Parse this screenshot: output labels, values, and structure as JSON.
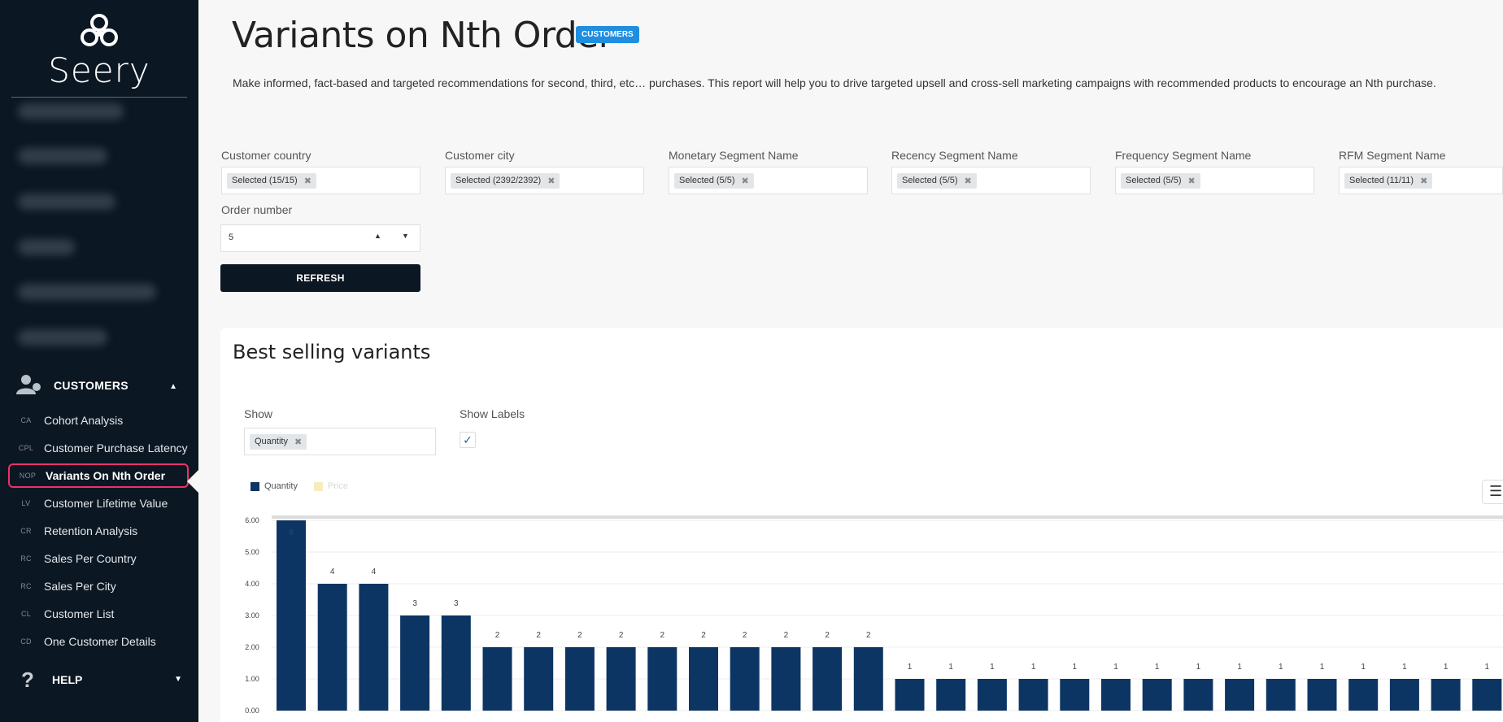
{
  "sidebar": {
    "logo_text": "Seery",
    "section": {
      "label": "CUSTOMERS"
    },
    "items": [
      {
        "abbr": "CA",
        "label": "Cohort Analysis"
      },
      {
        "abbr": "CPL",
        "label": "Customer Purchase Latency"
      },
      {
        "abbr": "NOP",
        "label": "Variants On Nth Order"
      },
      {
        "abbr": "LV",
        "label": "Customer Lifetime Value"
      },
      {
        "abbr": "CR",
        "label": "Retention Analysis"
      },
      {
        "abbr": "RC",
        "label": "Sales Per Country"
      },
      {
        "abbr": "RC",
        "label": "Sales Per City"
      },
      {
        "abbr": "CL",
        "label": "Customer List"
      },
      {
        "abbr": "CD",
        "label": "One Customer Details"
      }
    ],
    "help": {
      "label": "HELP"
    }
  },
  "header": {
    "title": "Variants on Nth Order",
    "badge": "CUSTOMERS",
    "description": "Make informed, fact-based and targeted recommendations for second, third, etc… purchases. This report will help you to drive targeted upsell and cross-sell marketing campaigns with recommended products to encourage an Nth purchase."
  },
  "filters": [
    {
      "label": "Customer country",
      "chip": "Selected (15/15)"
    },
    {
      "label": "Customer city",
      "chip": "Selected (2392/2392)"
    },
    {
      "label": "Monetary Segment Name",
      "chip": "Selected (5/5)"
    },
    {
      "label": "Recency Segment Name",
      "chip": "Selected (5/5)"
    },
    {
      "label": "Frequency Segment Name",
      "chip": "Selected (5/5)"
    },
    {
      "label": "RFM Segment Name",
      "chip": "Selected (11/11)"
    }
  ],
  "order_number": {
    "label": "Order number",
    "value": "5"
  },
  "refresh_label": "REFRESH",
  "card": {
    "title": "Best selling variants",
    "show_label": "Show",
    "show_chip": "Quantity",
    "show_labels_label": "Show Labels",
    "show_labels_checked": true
  },
  "colors": {
    "quantity": "#0d3563",
    "price": "#f7ecc0",
    "accent": "#1f8ee0",
    "active_border": "#e8336b"
  },
  "chart_data": {
    "type": "bar",
    "title": "",
    "legend": [
      "Quantity",
      "Price"
    ],
    "legend_position": "top-left",
    "ylim": [
      0,
      6
    ],
    "yticks": [
      "0.00",
      "1.00",
      "2.00",
      "3.00",
      "4.00",
      "5.00",
      "6.00"
    ],
    "grid": true,
    "series": [
      {
        "name": "Quantity",
        "values": [
          6,
          4,
          4,
          3,
          3,
          2,
          2,
          2,
          2,
          2,
          2,
          2,
          2,
          2,
          2,
          1,
          1,
          1,
          1,
          1,
          1,
          1,
          1,
          1,
          1,
          1,
          1,
          1,
          1,
          1
        ]
      }
    ]
  }
}
